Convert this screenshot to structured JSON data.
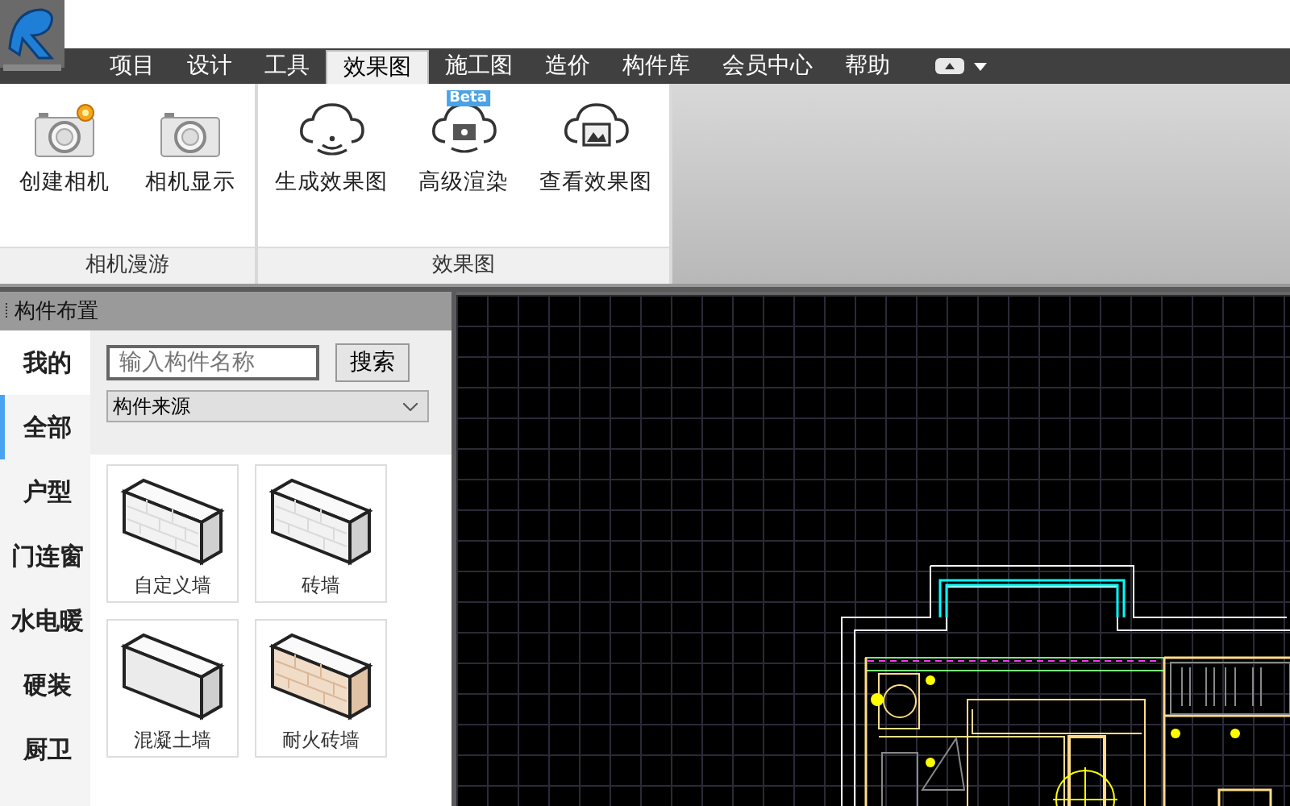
{
  "menu": [
    {
      "label": "项目",
      "selected": false
    },
    {
      "label": "设计",
      "selected": false
    },
    {
      "label": "工具",
      "selected": false
    },
    {
      "label": "效果图",
      "selected": true
    },
    {
      "label": "施工图",
      "selected": false
    },
    {
      "label": "造价",
      "selected": false
    },
    {
      "label": "构件库",
      "selected": false
    },
    {
      "label": "会员中心",
      "selected": false
    },
    {
      "label": "帮助",
      "selected": false
    }
  ],
  "ribbon": [
    {
      "title": "相机漫游",
      "tools": [
        {
          "label": "创建相机",
          "kind": "camera-new"
        },
        {
          "label": "相机显示",
          "kind": "camera"
        }
      ]
    },
    {
      "title": "效果图",
      "tools": [
        {
          "label": "生成效果图",
          "kind": "cloud-signal"
        },
        {
          "label": "高级渲染",
          "kind": "cloud-render",
          "badge": "Beta"
        },
        {
          "label": "查看效果图",
          "kind": "cloud-image"
        }
      ]
    }
  ],
  "panel": {
    "title": "构件布置",
    "categories": [
      {
        "label": "我的",
        "selected": false
      },
      {
        "label": "全部",
        "selected": true
      },
      {
        "label": "户型",
        "selected": false
      },
      {
        "label": "门连窗",
        "selected": false
      },
      {
        "label": "水电暖",
        "selected": false
      },
      {
        "label": "硬装",
        "selected": false
      },
      {
        "label": "厨卫",
        "selected": false
      }
    ],
    "search": {
      "placeholder": "输入构件名称",
      "button": "搜索"
    },
    "source": "构件来源",
    "items": [
      {
        "label": "自定义墙",
        "kind": "brick"
      },
      {
        "label": "砖墙",
        "kind": "brick"
      },
      {
        "label": "混凝土墙",
        "kind": "concrete"
      },
      {
        "label": "耐火砖墙",
        "kind": "firebrick"
      }
    ]
  }
}
